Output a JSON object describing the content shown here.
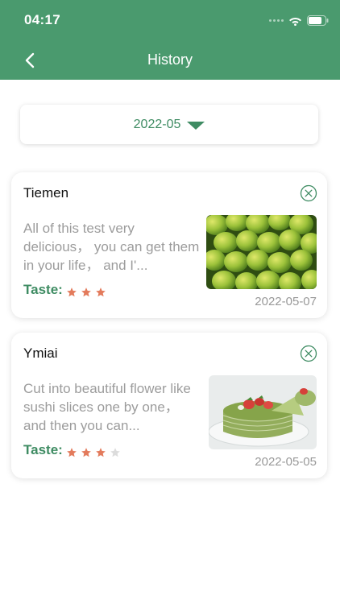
{
  "status_bar": {
    "time": "04:17"
  },
  "header": {
    "title": "History"
  },
  "date_filter": {
    "selected": "2022-05"
  },
  "colors": {
    "primary": "#4a9a6e",
    "accent_text": "#3f8c63",
    "star_on": "#e37b5c",
    "star_off": "#dcdcdc"
  },
  "items": [
    {
      "title": "Tiemen",
      "description": "All of this test very delicious， you can get them in your life， and I'...",
      "taste_label": "Taste:",
      "rating": 3,
      "max_rating": 3,
      "date": "2022-05-07",
      "image": "green-fruit-photo"
    },
    {
      "title": "Ymiai",
      "description": "Cut into beautiful flower like sushi slices one by one， and then you can...",
      "taste_label": "Taste:",
      "rating": 3,
      "max_rating": 4,
      "date": "2022-05-05",
      "image": "matcha-crepe-cake-photo"
    }
  ]
}
